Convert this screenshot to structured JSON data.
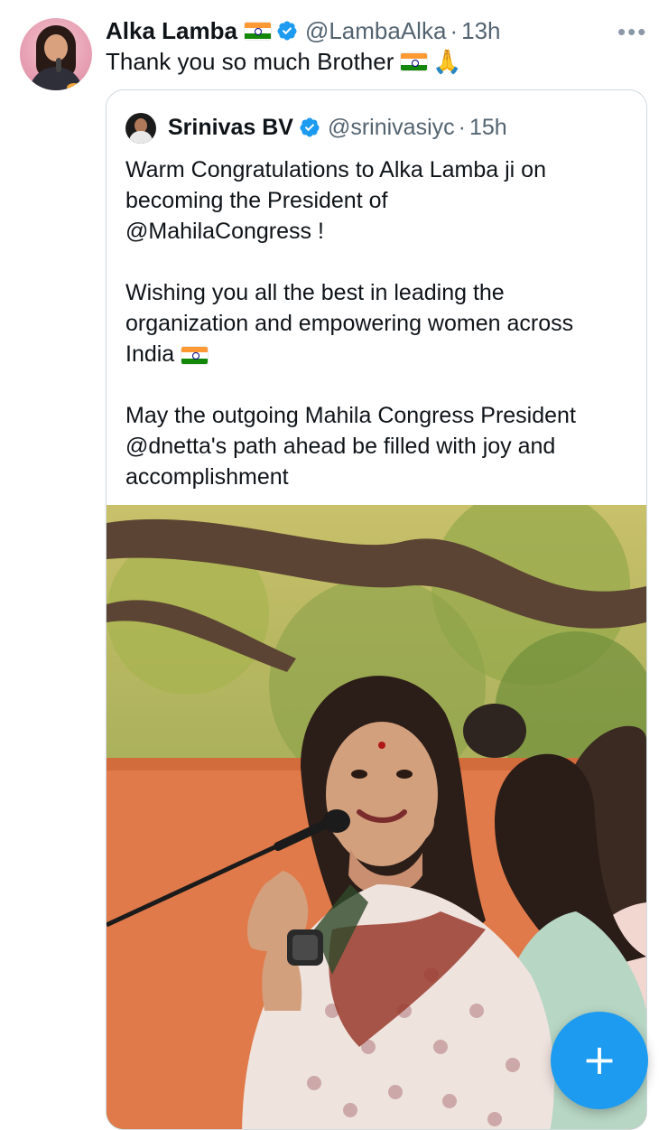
{
  "tweet": {
    "author_name": "Alka Lamba",
    "handle": "@LambaAlka",
    "separator": "·",
    "time": "13h",
    "more_label": "•••",
    "text": "Thank you so much Brother",
    "pray_emoji": "🙏"
  },
  "quoted_tweet": {
    "author_name": "Srinivas BV",
    "handle": "@srinivasiyc",
    "separator": "·",
    "time": "15h",
    "paragraph_1_lines": [
      "Warm Congratulations to Alka Lamba ji on",
      "becoming the President of",
      "@MahilaCongress !"
    ],
    "paragraph_2_lines": [
      "Wishing you all the best in leading the",
      "organization and empowering women across",
      "India"
    ],
    "paragraph_3_lines": [
      "May the outgoing Mahila Congress President",
      "@dnetta's path ahead be filled with joy and",
      "accomplishment"
    ]
  },
  "compose_button": {
    "label": "+"
  },
  "colors": {
    "accent": "#1d9bf0",
    "muted_text": "#536471",
    "text": "#0f1419",
    "border": "#cfd9de"
  },
  "icons": [
    "verified-badge-icon",
    "india-flag-icon",
    "more-icon",
    "compose-plus-icon"
  ]
}
